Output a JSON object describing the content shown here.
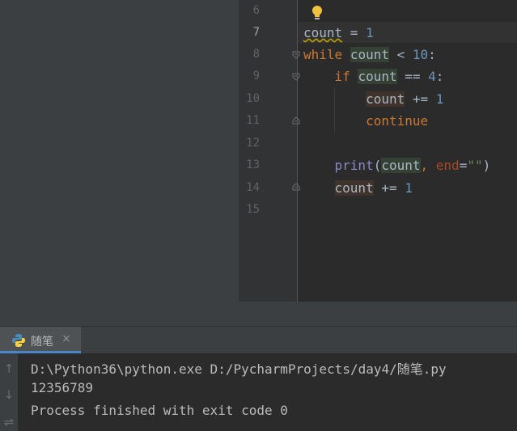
{
  "editor": {
    "line_numbers": [
      "6",
      "7",
      "8",
      "9",
      "10",
      "11",
      "12",
      "13",
      "14",
      "15"
    ],
    "active_line": "7",
    "tokens": {
      "l7_var": "count",
      "l7_op": " = ",
      "l7_num": "1",
      "l8_kw": "while",
      "l8_sp": " ",
      "l8_var": "count",
      "l8_op": " < ",
      "l8_num": "10",
      "l8_colon": ":",
      "l9_indent": "    ",
      "l9_kw": "if",
      "l9_sp": " ",
      "l9_var": "count",
      "l9_op": " == ",
      "l9_num": "4",
      "l9_colon": ":",
      "l10_indent": "        ",
      "l10_var": "count",
      "l10_op": " += ",
      "l10_num": "1",
      "l11_indent": "        ",
      "l11_kw": "continue",
      "l13_indent": "    ",
      "l13_fn": "print",
      "l13_paren": "(",
      "l13_var": "count",
      "l13_comma": ", ",
      "l13_param": "end",
      "l13_eq": "=",
      "l13_str": "\"\"",
      "l13_close": ")",
      "l14_indent": "    ",
      "l14_var": "count",
      "l14_op": " += ",
      "l14_num": "1"
    }
  },
  "run_panel": {
    "tab_label": "随笔",
    "tab_close": "×"
  },
  "console": {
    "lines": [
      "D:\\Python36\\python.exe D:/PycharmProjects/day4/随笔.py",
      "12356789",
      "Process finished with exit code 0"
    ],
    "tools": [
      "↑",
      "↓",
      "⇌"
    ]
  },
  "colors": {
    "keyword": "#cc7832",
    "number": "#6897bb",
    "builtin": "#8888c6",
    "string": "#6a8759",
    "param": "#aa4926"
  }
}
